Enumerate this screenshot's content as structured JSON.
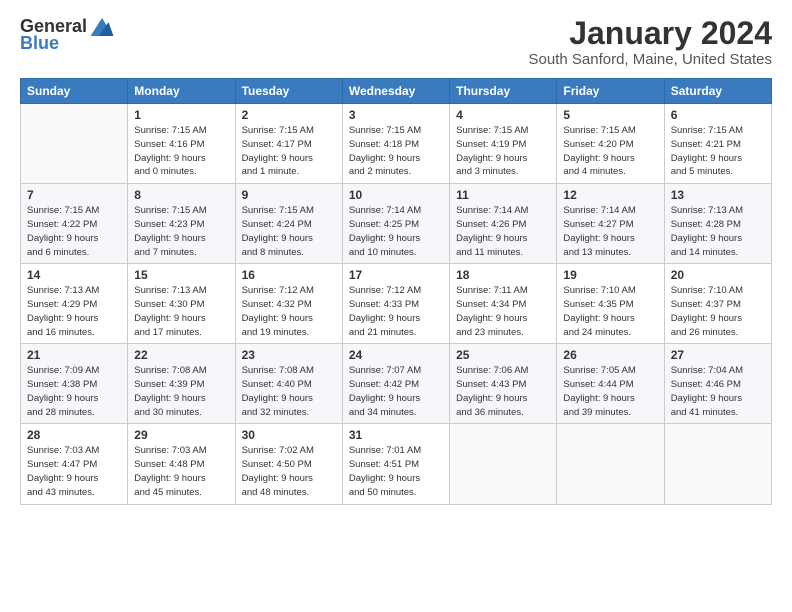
{
  "logo": {
    "general": "General",
    "blue": "Blue"
  },
  "header": {
    "title": "January 2024",
    "location": "South Sanford, Maine, United States"
  },
  "weekdays": [
    "Sunday",
    "Monday",
    "Tuesday",
    "Wednesday",
    "Thursday",
    "Friday",
    "Saturday"
  ],
  "weeks": [
    [
      {
        "day": "",
        "info": ""
      },
      {
        "day": "1",
        "info": "Sunrise: 7:15 AM\nSunset: 4:16 PM\nDaylight: 9 hours\nand 0 minutes."
      },
      {
        "day": "2",
        "info": "Sunrise: 7:15 AM\nSunset: 4:17 PM\nDaylight: 9 hours\nand 1 minute."
      },
      {
        "day": "3",
        "info": "Sunrise: 7:15 AM\nSunset: 4:18 PM\nDaylight: 9 hours\nand 2 minutes."
      },
      {
        "day": "4",
        "info": "Sunrise: 7:15 AM\nSunset: 4:19 PM\nDaylight: 9 hours\nand 3 minutes."
      },
      {
        "day": "5",
        "info": "Sunrise: 7:15 AM\nSunset: 4:20 PM\nDaylight: 9 hours\nand 4 minutes."
      },
      {
        "day": "6",
        "info": "Sunrise: 7:15 AM\nSunset: 4:21 PM\nDaylight: 9 hours\nand 5 minutes."
      }
    ],
    [
      {
        "day": "7",
        "info": "Sunrise: 7:15 AM\nSunset: 4:22 PM\nDaylight: 9 hours\nand 6 minutes."
      },
      {
        "day": "8",
        "info": "Sunrise: 7:15 AM\nSunset: 4:23 PM\nDaylight: 9 hours\nand 7 minutes."
      },
      {
        "day": "9",
        "info": "Sunrise: 7:15 AM\nSunset: 4:24 PM\nDaylight: 9 hours\nand 8 minutes."
      },
      {
        "day": "10",
        "info": "Sunrise: 7:14 AM\nSunset: 4:25 PM\nDaylight: 9 hours\nand 10 minutes."
      },
      {
        "day": "11",
        "info": "Sunrise: 7:14 AM\nSunset: 4:26 PM\nDaylight: 9 hours\nand 11 minutes."
      },
      {
        "day": "12",
        "info": "Sunrise: 7:14 AM\nSunset: 4:27 PM\nDaylight: 9 hours\nand 13 minutes."
      },
      {
        "day": "13",
        "info": "Sunrise: 7:13 AM\nSunset: 4:28 PM\nDaylight: 9 hours\nand 14 minutes."
      }
    ],
    [
      {
        "day": "14",
        "info": "Sunrise: 7:13 AM\nSunset: 4:29 PM\nDaylight: 9 hours\nand 16 minutes."
      },
      {
        "day": "15",
        "info": "Sunrise: 7:13 AM\nSunset: 4:30 PM\nDaylight: 9 hours\nand 17 minutes."
      },
      {
        "day": "16",
        "info": "Sunrise: 7:12 AM\nSunset: 4:32 PM\nDaylight: 9 hours\nand 19 minutes."
      },
      {
        "day": "17",
        "info": "Sunrise: 7:12 AM\nSunset: 4:33 PM\nDaylight: 9 hours\nand 21 minutes."
      },
      {
        "day": "18",
        "info": "Sunrise: 7:11 AM\nSunset: 4:34 PM\nDaylight: 9 hours\nand 23 minutes."
      },
      {
        "day": "19",
        "info": "Sunrise: 7:10 AM\nSunset: 4:35 PM\nDaylight: 9 hours\nand 24 minutes."
      },
      {
        "day": "20",
        "info": "Sunrise: 7:10 AM\nSunset: 4:37 PM\nDaylight: 9 hours\nand 26 minutes."
      }
    ],
    [
      {
        "day": "21",
        "info": "Sunrise: 7:09 AM\nSunset: 4:38 PM\nDaylight: 9 hours\nand 28 minutes."
      },
      {
        "day": "22",
        "info": "Sunrise: 7:08 AM\nSunset: 4:39 PM\nDaylight: 9 hours\nand 30 minutes."
      },
      {
        "day": "23",
        "info": "Sunrise: 7:08 AM\nSunset: 4:40 PM\nDaylight: 9 hours\nand 32 minutes."
      },
      {
        "day": "24",
        "info": "Sunrise: 7:07 AM\nSunset: 4:42 PM\nDaylight: 9 hours\nand 34 minutes."
      },
      {
        "day": "25",
        "info": "Sunrise: 7:06 AM\nSunset: 4:43 PM\nDaylight: 9 hours\nand 36 minutes."
      },
      {
        "day": "26",
        "info": "Sunrise: 7:05 AM\nSunset: 4:44 PM\nDaylight: 9 hours\nand 39 minutes."
      },
      {
        "day": "27",
        "info": "Sunrise: 7:04 AM\nSunset: 4:46 PM\nDaylight: 9 hours\nand 41 minutes."
      }
    ],
    [
      {
        "day": "28",
        "info": "Sunrise: 7:03 AM\nSunset: 4:47 PM\nDaylight: 9 hours\nand 43 minutes."
      },
      {
        "day": "29",
        "info": "Sunrise: 7:03 AM\nSunset: 4:48 PM\nDaylight: 9 hours\nand 45 minutes."
      },
      {
        "day": "30",
        "info": "Sunrise: 7:02 AM\nSunset: 4:50 PM\nDaylight: 9 hours\nand 48 minutes."
      },
      {
        "day": "31",
        "info": "Sunrise: 7:01 AM\nSunset: 4:51 PM\nDaylight: 9 hours\nand 50 minutes."
      },
      {
        "day": "",
        "info": ""
      },
      {
        "day": "",
        "info": ""
      },
      {
        "day": "",
        "info": ""
      }
    ]
  ]
}
